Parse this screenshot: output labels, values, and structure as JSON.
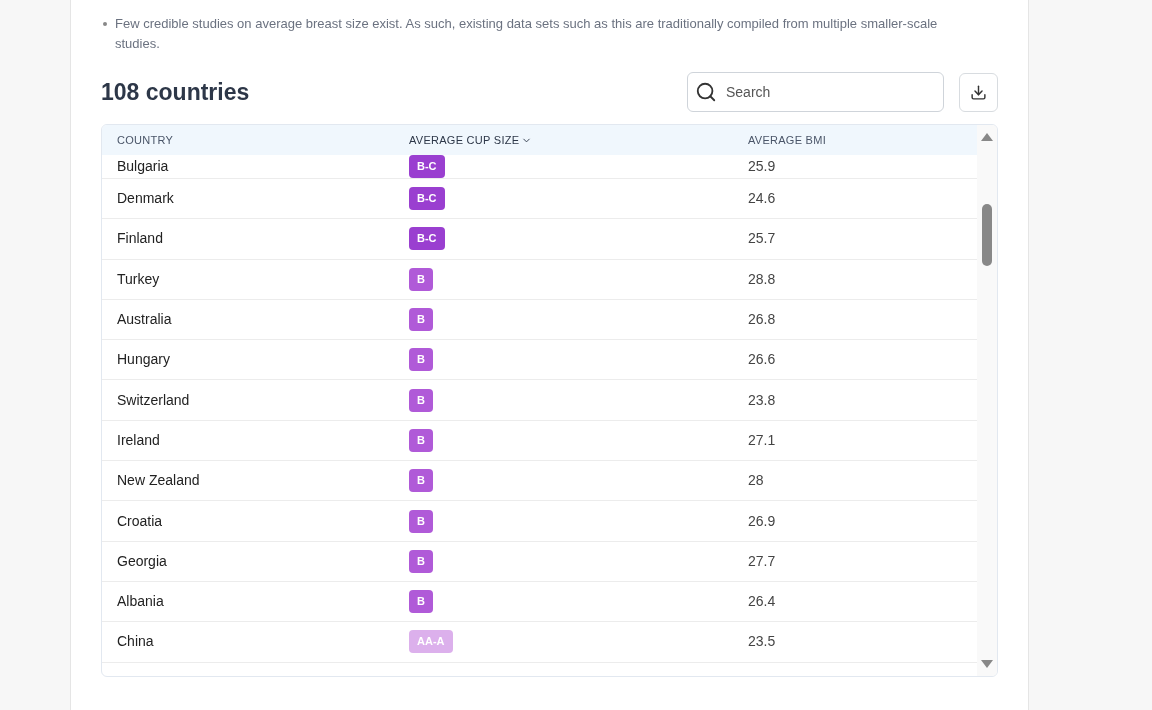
{
  "note": "Few credible studies on average breast size exist. As such, existing data sets such as this are traditionally compiled from multiple smaller-scale studies.",
  "heading": "108 countries",
  "search": {
    "placeholder": "Search"
  },
  "table": {
    "columns": [
      {
        "label": "COUNTRY",
        "sorted": false
      },
      {
        "label": "AVERAGE CUP SIZE",
        "sorted": true
      },
      {
        "label": "AVERAGE BMI",
        "sorted": false
      }
    ],
    "rows": [
      {
        "country": "Bulgaria",
        "cup": "B-C",
        "color": "#9a3fd0",
        "bmi": "25.9"
      },
      {
        "country": "Denmark",
        "cup": "B-C",
        "color": "#9a3fd0",
        "bmi": "24.6"
      },
      {
        "country": "Finland",
        "cup": "B-C",
        "color": "#9a3fd0",
        "bmi": "25.7"
      },
      {
        "country": "Turkey",
        "cup": "B",
        "color": "#b05ad8",
        "bmi": "28.8"
      },
      {
        "country": "Australia",
        "cup": "B",
        "color": "#b05ad8",
        "bmi": "26.8"
      },
      {
        "country": "Hungary",
        "cup": "B",
        "color": "#b05ad8",
        "bmi": "26.6"
      },
      {
        "country": "Switzerland",
        "cup": "B",
        "color": "#b05ad8",
        "bmi": "23.8"
      },
      {
        "country": "Ireland",
        "cup": "B",
        "color": "#b05ad8",
        "bmi": "27.1"
      },
      {
        "country": "New Zealand",
        "cup": "B",
        "color": "#b05ad8",
        "bmi": "28"
      },
      {
        "country": "Croatia",
        "cup": "B",
        "color": "#b05ad8",
        "bmi": "26.9"
      },
      {
        "country": "Georgia",
        "cup": "B",
        "color": "#b05ad8",
        "bmi": "27.7"
      },
      {
        "country": "Albania",
        "cup": "B",
        "color": "#b05ad8",
        "bmi": "26.4"
      },
      {
        "country": "China",
        "cup": "AA-A",
        "color": "#dcb0ec",
        "bmi": "23.5"
      }
    ]
  }
}
